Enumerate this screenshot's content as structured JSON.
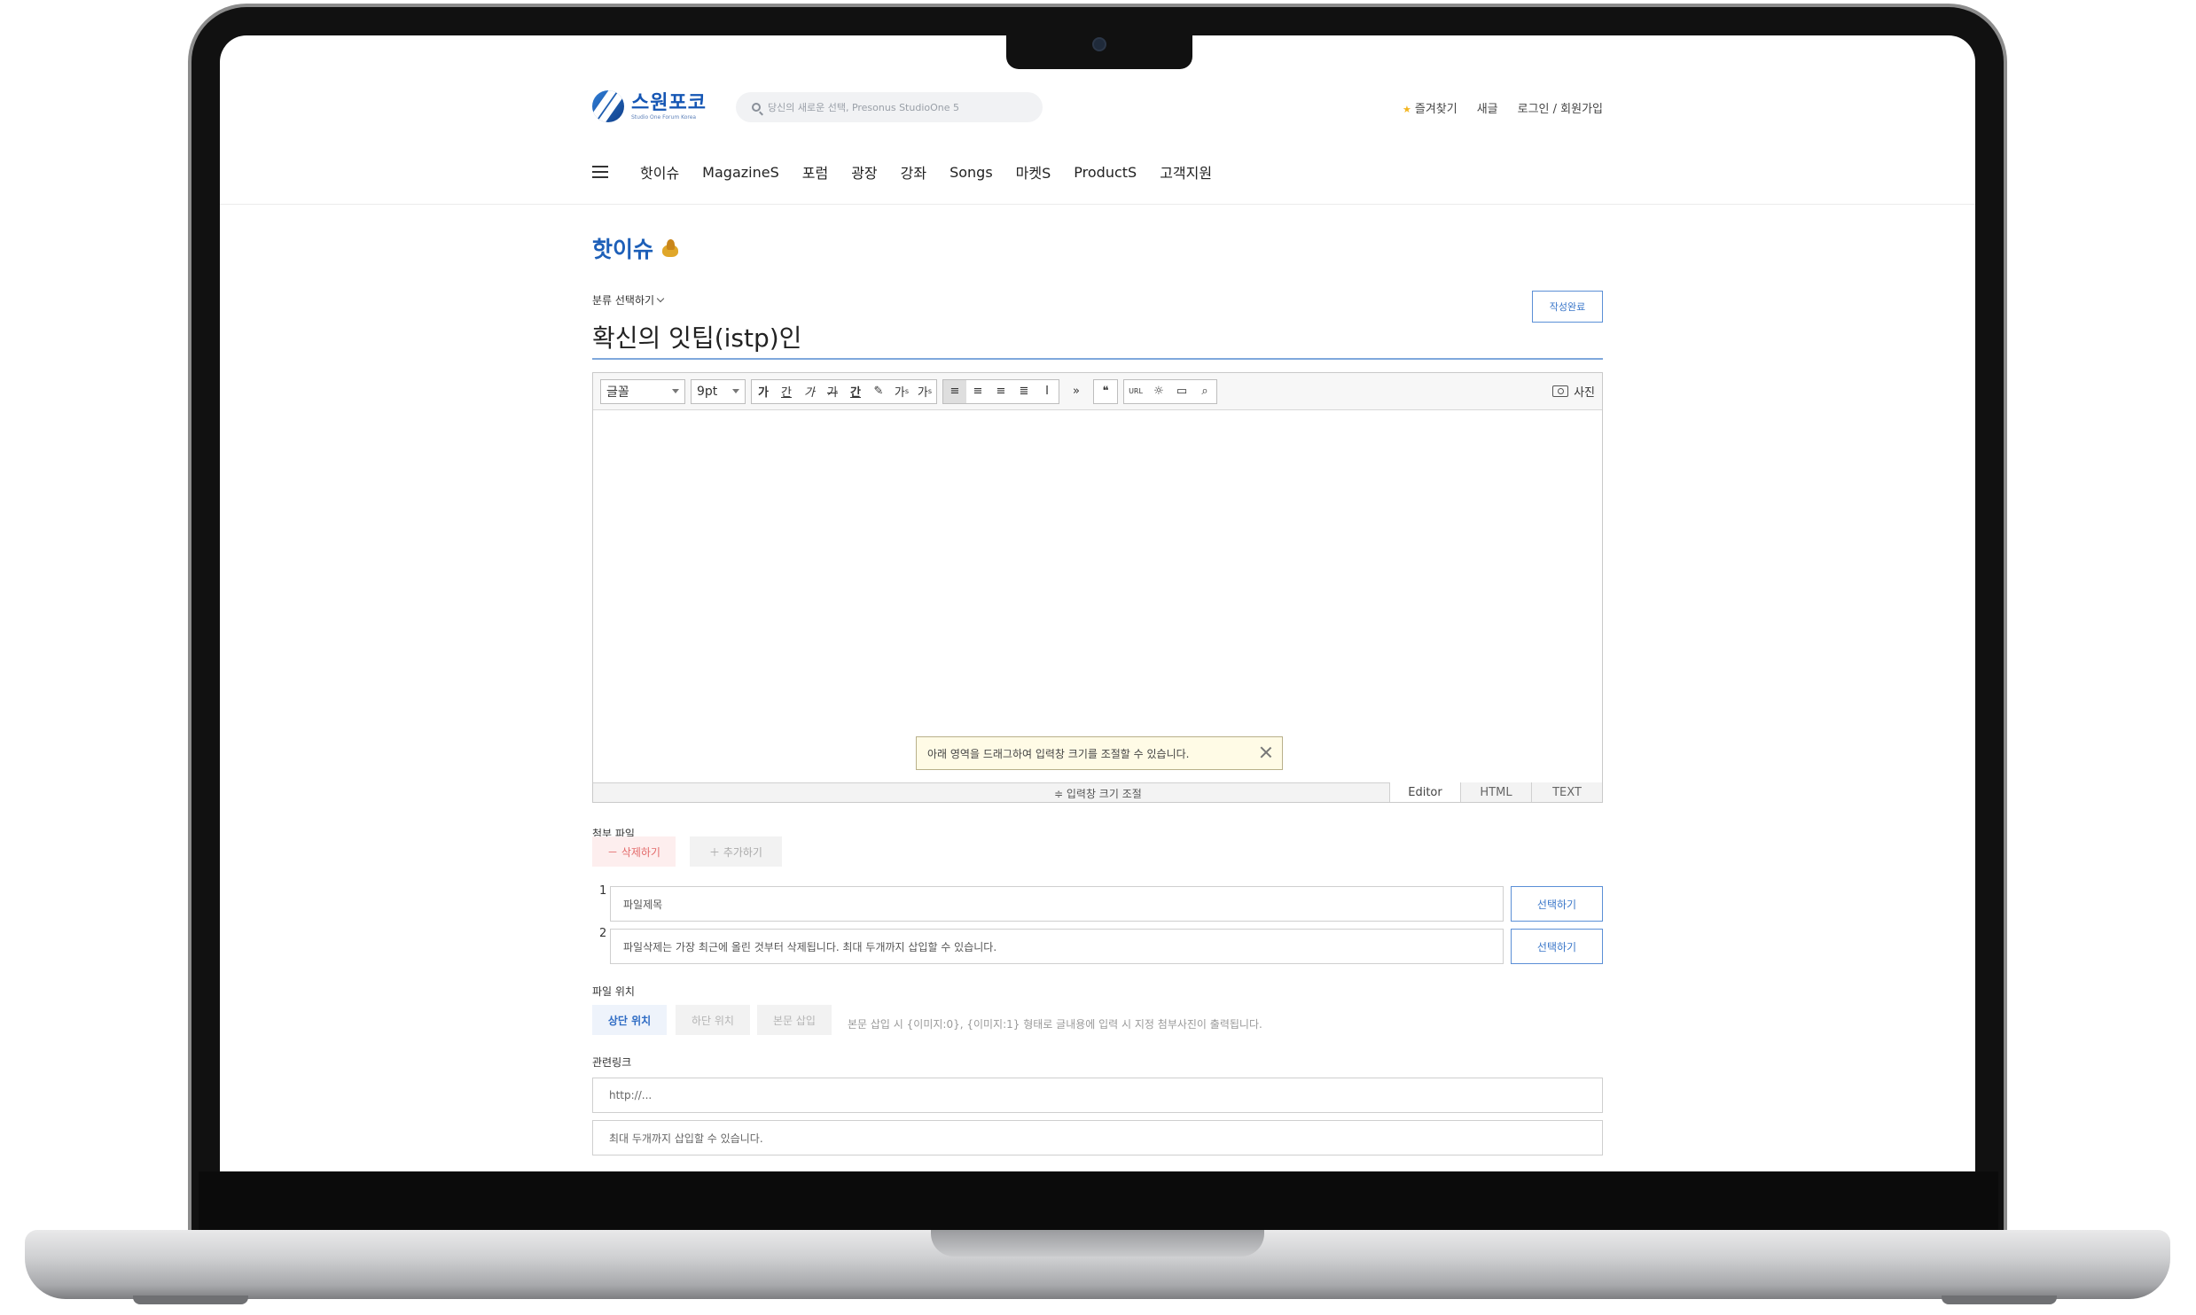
{
  "header": {
    "logo_title": "스원포코",
    "logo_sub": "Studio One Forum Korea",
    "search_placeholder": "당신의 새로운 선택, Presonus StudioOne 5",
    "links": [
      "즐겨찾기",
      "새글",
      "로그인 / 회원가입"
    ]
  },
  "nav": {
    "items": [
      "핫이슈",
      "MagazineS",
      "포럼",
      "광장",
      "강좌",
      "Songs",
      "마켓S",
      "ProductS",
      "고객지원"
    ]
  },
  "page": {
    "title": "핫이슈",
    "category_label": "분류 선택하기",
    "submit_label": "작성완료",
    "post_title": "확신의 잇팁(istp)인"
  },
  "editor": {
    "font_select": "글꼴",
    "size_select": "9pt",
    "buttons": [
      "가",
      "간",
      "가",
      "가",
      "간",
      "가",
      "가",
      "가"
    ],
    "photo_label": "사진",
    "tooltip": "아래 영역을 드래그하여 입력창 크기를 조절할 수 있습니다.",
    "resize_label": "≑ 입력창 크기 조절",
    "modes": [
      "Editor",
      "HTML",
      "TEXT"
    ]
  },
  "attach": {
    "label": "첨부 파일",
    "delete_label": "－ 삭제하기",
    "add_label": "＋ 추가하기",
    "files": [
      {
        "num": "1",
        "value": "파일제목"
      },
      {
        "num": "2",
        "value": "파일삭제는 가장 최근에 올린 것부터 삭제됩니다. 최대 두개까지 삽입할 수 있습니다."
      }
    ],
    "choose_label": "선택하기"
  },
  "position": {
    "label": "파일 위치",
    "options": [
      "상단 위치",
      "하단 위치",
      "본문 삽입"
    ],
    "note": "본문 삽입 시 {이미지:0}, {이미지:1} 형태로 글내용에 입력 시 지정 첨부사진이 출력됩니다."
  },
  "links": {
    "label": "관련링크",
    "placeholder_1": "http://...",
    "placeholder_2": "최대 두개까지 삽입할 수 있습니다."
  },
  "colors": {
    "accent": "#1d5fb8",
    "button_border": "#5b8fd6",
    "delete_red": "#e36b6b"
  }
}
